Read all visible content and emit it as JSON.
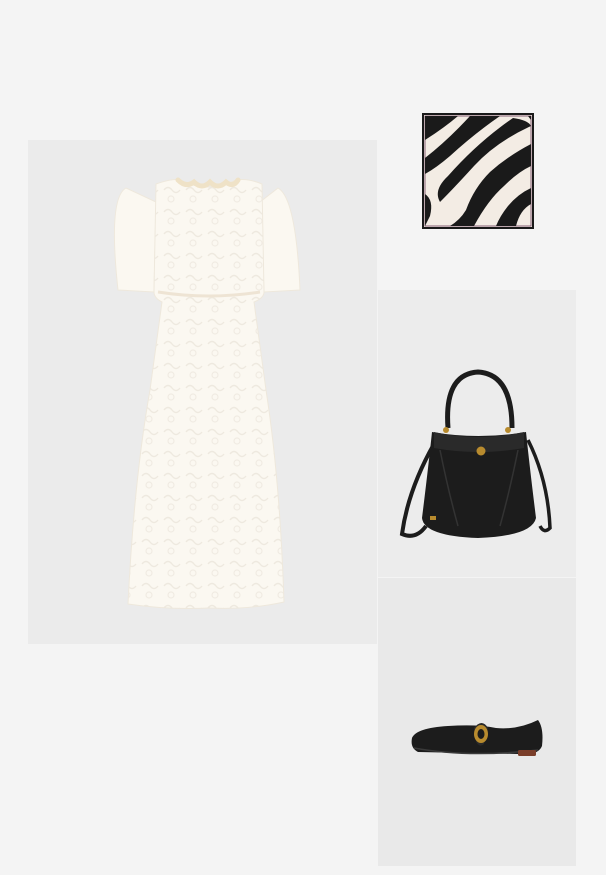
{
  "products": [
    {
      "id": "dress",
      "name": "",
      "price": ""
    },
    {
      "id": "scarf",
      "name": "",
      "price": ""
    },
    {
      "id": "bag",
      "name": "",
      "price": ""
    },
    {
      "id": "shoes",
      "name": "",
      "price": ""
    }
  ],
  "colors": {
    "page_background": "#f4f4f4",
    "dress": "#fbf8f1",
    "dress_collar": "#efe2c7",
    "scarf_black": "#1a1a1a",
    "scarf_cream": "#f3ece4",
    "bag_black": "#1c1c1c",
    "hardware_gold": "#b88b2e"
  }
}
